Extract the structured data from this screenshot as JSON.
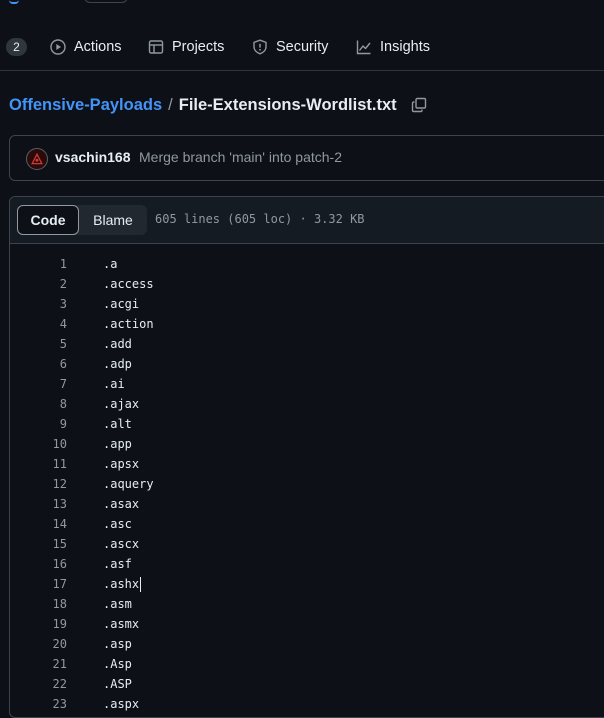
{
  "nav": {
    "counter": "2",
    "tabs": [
      {
        "label": "Actions",
        "icon": "play-circle-icon"
      },
      {
        "label": "Projects",
        "icon": "table-icon"
      },
      {
        "label": "Security",
        "icon": "shield-icon"
      },
      {
        "label": "Insights",
        "icon": "graph-icon"
      }
    ]
  },
  "breadcrumb": {
    "repo": "Offensive-Payloads",
    "separator": "/",
    "file": "File-Extensions-Wordlist.txt"
  },
  "commit": {
    "author": "vsachin168",
    "message": "Merge branch 'main' into patch-2"
  },
  "code_view": {
    "code_label": "Code",
    "blame_label": "Blame",
    "meta": "605 lines (605 loc) · 3.32 KB"
  },
  "lines": [
    {
      "num": "1",
      "text": ".a"
    },
    {
      "num": "2",
      "text": ".access"
    },
    {
      "num": "3",
      "text": ".acgi"
    },
    {
      "num": "4",
      "text": ".action"
    },
    {
      "num": "5",
      "text": ".add"
    },
    {
      "num": "6",
      "text": ".adp"
    },
    {
      "num": "7",
      "text": ".ai"
    },
    {
      "num": "8",
      "text": ".ajax"
    },
    {
      "num": "9",
      "text": ".alt"
    },
    {
      "num": "10",
      "text": ".app"
    },
    {
      "num": "11",
      "text": ".apsx"
    },
    {
      "num": "12",
      "text": ".aquery"
    },
    {
      "num": "13",
      "text": ".asax"
    },
    {
      "num": "14",
      "text": ".asc"
    },
    {
      "num": "15",
      "text": ".ascx"
    },
    {
      "num": "16",
      "text": ".asf"
    },
    {
      "num": "17",
      "text": ".ashx"
    },
    {
      "num": "18",
      "text": ".asm"
    },
    {
      "num": "19",
      "text": ".asmx"
    },
    {
      "num": "20",
      "text": ".asp"
    },
    {
      "num": "21",
      "text": ".Asp"
    },
    {
      "num": "22",
      "text": ".ASP"
    },
    {
      "num": "23",
      "text": ".aspx"
    }
  ],
  "colors": {
    "background": "#0d1117",
    "link": "#4493f8",
    "muted": "#9198a1",
    "border": "#3d444d"
  }
}
